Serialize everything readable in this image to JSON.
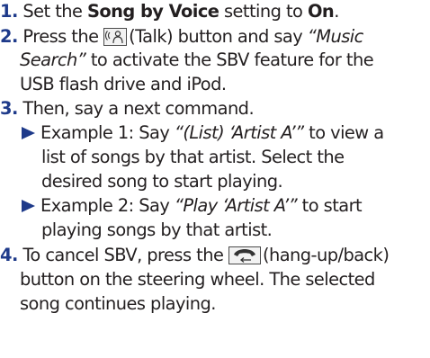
{
  "colors": {
    "number": "#1e3a8a",
    "text": "#231f20",
    "marker": "#1e3a8a"
  },
  "step1": {
    "num": "1.",
    "pre": "Set the ",
    "setting": "Song by Voice",
    "mid": " setting to ",
    "value": "On",
    "end": "."
  },
  "step2": {
    "num": "2.",
    "pre": "Press the ",
    "icon": "talk-icon",
    "button_name": "(Talk) button and say ",
    "quote_line1": "“Music",
    "quote_line2": "Search”",
    "line2_rest": " to activate the SBV feature for the",
    "line3": "USB flash drive and iPod."
  },
  "step3": {
    "num": "3.",
    "text": "Then, say a next command.",
    "example1": {
      "label": "Example 1: Say ",
      "command": "“(List) ‘Artist A’”",
      "line1_rest": " to view a",
      "line2": "list of songs by that artist. Select the",
      "line3": "desired song to start playing."
    },
    "example2": {
      "label": "Example 2: Say ",
      "command": "“Play ‘Artist A’”",
      "line1_rest": " to start",
      "line2": "playing songs by that artist."
    }
  },
  "step4": {
    "num": "4.",
    "pre": "To cancel SBV, press the ",
    "icon": "hang-up-back-icon",
    "line1_rest": "(hang-up/back)",
    "line2": "button on the steering wheel. The selected",
    "line3": "song continues playing."
  }
}
